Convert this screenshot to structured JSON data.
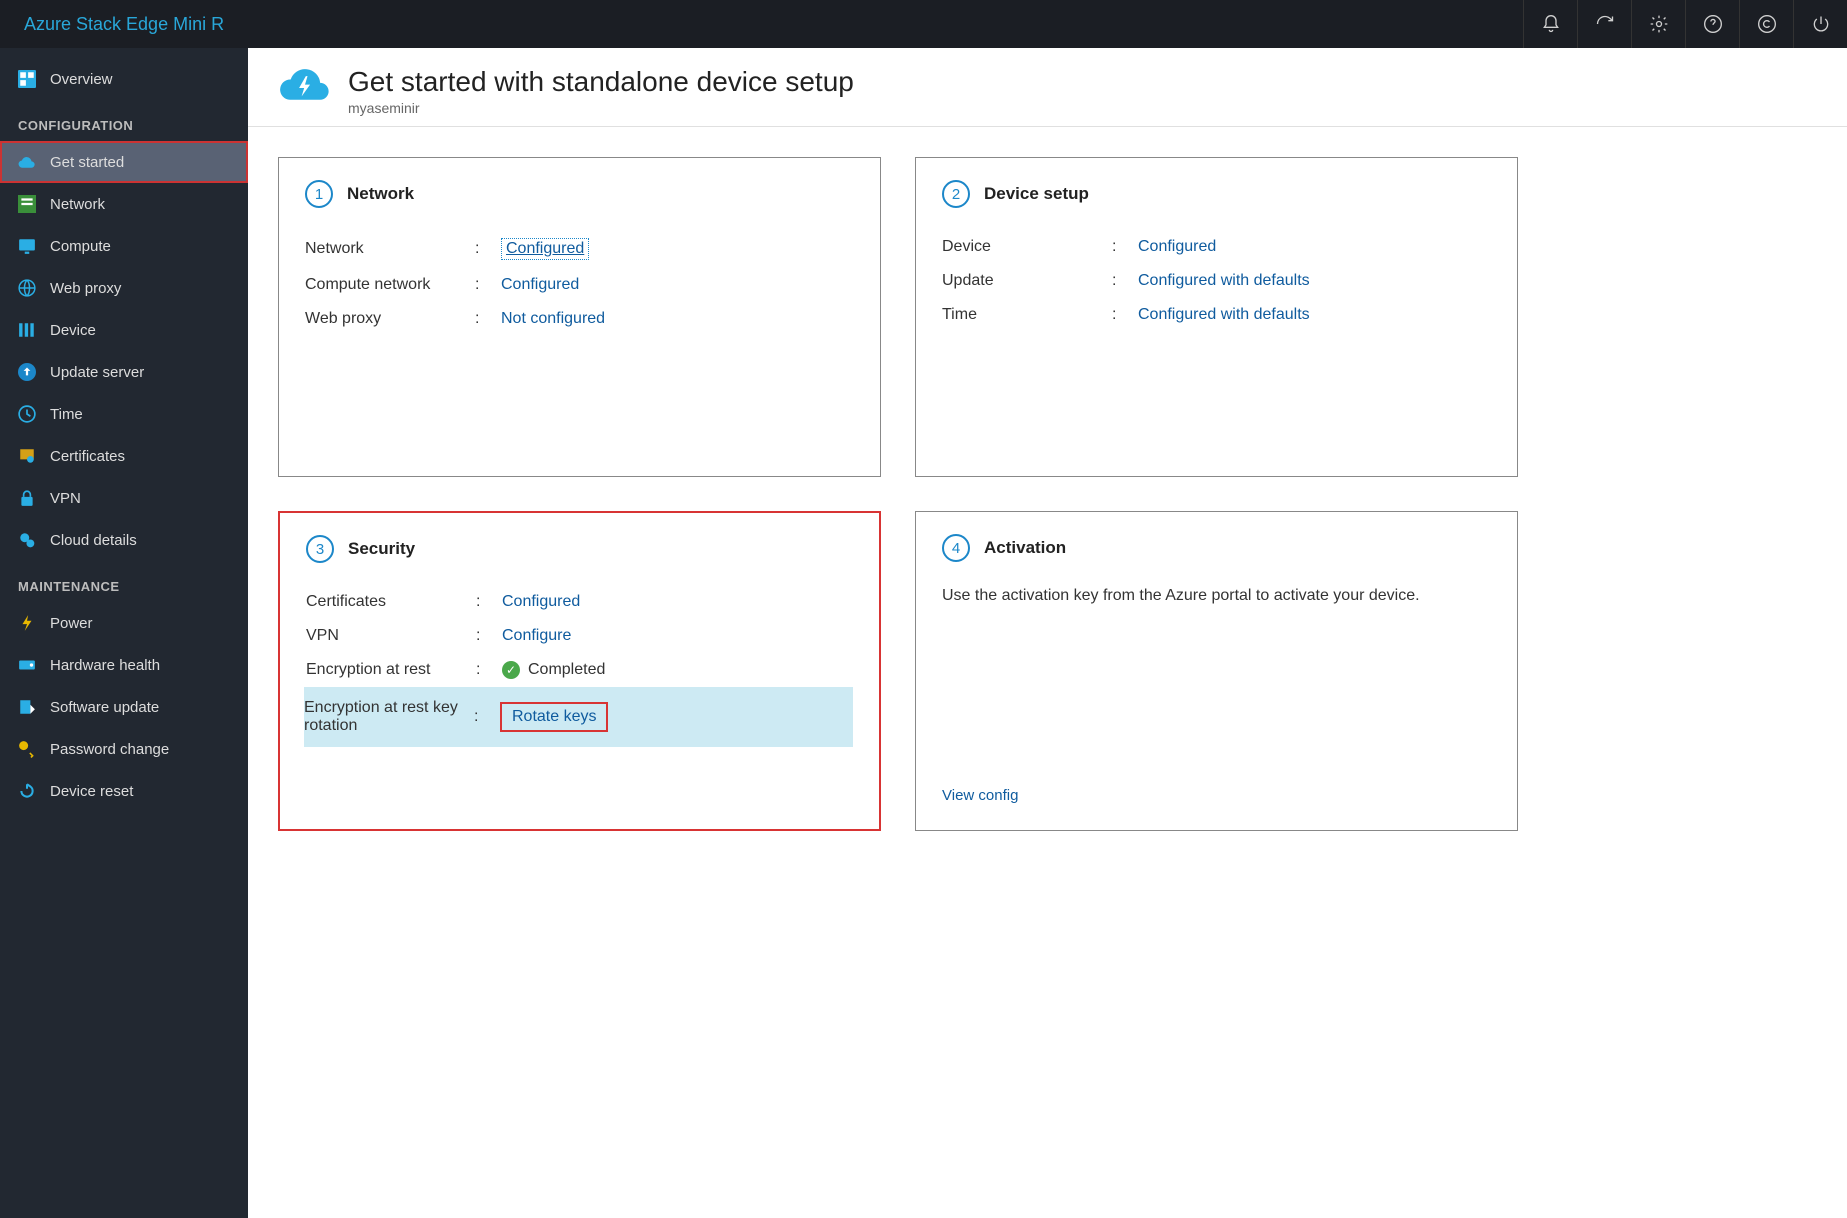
{
  "app_title": "Azure Stack Edge Mini R",
  "topbar_icons": [
    "bell-icon",
    "refresh-icon",
    "gear-icon",
    "help-icon",
    "copyright-icon",
    "power-icon"
  ],
  "sidebar": {
    "overview": "Overview",
    "section_configuration": "Configuration",
    "config_items": [
      {
        "label": "Get started",
        "icon": "cloud-bolt-icon",
        "selected": true
      },
      {
        "label": "Network",
        "icon": "server-icon"
      },
      {
        "label": "Compute",
        "icon": "monitor-icon"
      },
      {
        "label": "Web proxy",
        "icon": "globe-icon"
      },
      {
        "label": "Device",
        "icon": "bars-icon"
      },
      {
        "label": "Update server",
        "icon": "upload-icon"
      },
      {
        "label": "Time",
        "icon": "clock-icon"
      },
      {
        "label": "Certificates",
        "icon": "certificate-icon"
      },
      {
        "label": "VPN",
        "icon": "lock-icon"
      },
      {
        "label": "Cloud details",
        "icon": "gears-icon"
      }
    ],
    "section_maintenance": "Maintenance",
    "maint_items": [
      {
        "label": "Power",
        "icon": "bolt-icon"
      },
      {
        "label": "Hardware health",
        "icon": "hardware-icon"
      },
      {
        "label": "Software update",
        "icon": "software-icon"
      },
      {
        "label": "Password change",
        "icon": "key-icon"
      },
      {
        "label": "Device reset",
        "icon": "reset-icon"
      }
    ]
  },
  "page": {
    "title": "Get started with standalone device setup",
    "subtitle": "myaseminir"
  },
  "cards": {
    "network": {
      "step": "1",
      "title": "Network",
      "rows": [
        {
          "label": "Network",
          "value": "Configured",
          "style": "dotted"
        },
        {
          "label": "Compute network",
          "value": "Configured"
        },
        {
          "label": "Web proxy",
          "value": "Not configured"
        }
      ]
    },
    "device": {
      "step": "2",
      "title": "Device setup",
      "rows": [
        {
          "label": "Device",
          "value": "Configured"
        },
        {
          "label": "Update",
          "value": "Configured with defaults"
        },
        {
          "label": "Time",
          "value": "Configured with defaults"
        }
      ]
    },
    "security": {
      "step": "3",
      "title": "Security",
      "rows": [
        {
          "label": "Certificates",
          "value": "Configured"
        },
        {
          "label": "VPN",
          "value": "Configure"
        },
        {
          "label": "Encryption at rest",
          "value": "Completed",
          "check": true
        },
        {
          "label": "Encryption at rest key rotation",
          "value": "Rotate keys",
          "highlight": true
        }
      ]
    },
    "activation": {
      "step": "4",
      "title": "Activation",
      "desc": "Use the activation key from the Azure portal to activate your device.",
      "footer_link": "View config"
    }
  }
}
